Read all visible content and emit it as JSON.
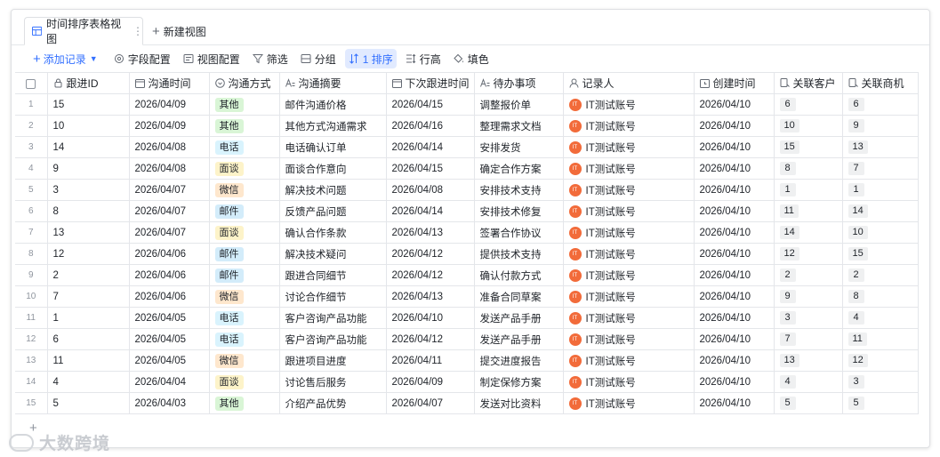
{
  "tabs": {
    "active_label": "时间排序表格视图",
    "more_label": "⋮",
    "new_view_label": "新建视图"
  },
  "toolbar": {
    "add_record_label": "添加记录",
    "field_config_label": "字段配置",
    "view_config_label": "视图配置",
    "filter_label": "筛选",
    "group_label": "分组",
    "sort_label": "1 排序",
    "row_height_label": "行高",
    "fill_label": "填色"
  },
  "columns": [
    {
      "label": "跟进ID",
      "icon": "lock-number-icon"
    },
    {
      "label": "沟通时间",
      "icon": "calendar-icon"
    },
    {
      "label": "沟通方式",
      "icon": "single-select-icon"
    },
    {
      "label": "沟通摘要",
      "icon": "text-icon"
    },
    {
      "label": "下次跟进时间",
      "icon": "calendar-icon"
    },
    {
      "label": "待办事项",
      "icon": "text-icon"
    },
    {
      "label": "记录人",
      "icon": "person-icon"
    },
    {
      "label": "创建时间",
      "icon": "created-time-icon"
    },
    {
      "label": "关联客户",
      "icon": "link-icon"
    },
    {
      "label": "关联商机",
      "icon": "link-icon"
    }
  ],
  "method_colors": {
    "其他": {
      "bg": "#d9f5d6",
      "fg": "#1f2329"
    },
    "电话": {
      "bg": "#d9f3fd",
      "fg": "#1f2329"
    },
    "面谈": {
      "bg": "#fdf3c9",
      "fg": "#1f2329"
    },
    "微信": {
      "bg": "#fee7cd",
      "fg": "#1f2329"
    },
    "邮件": {
      "bg": "#d3ecfa",
      "fg": "#1f2329"
    }
  },
  "recorder_avatar_text": "IT",
  "rows": [
    {
      "n": "1",
      "id": "15",
      "time": "2026/04/09",
      "method": "其他",
      "summary": "邮件沟通价格",
      "next": "2026/04/15",
      "todo": "调整报价单",
      "recorder": "IT测试账号",
      "created": "2026/04/10",
      "customer": "6",
      "opportunity": "6"
    },
    {
      "n": "2",
      "id": "10",
      "time": "2026/04/09",
      "method": "其他",
      "summary": "其他方式沟通需求",
      "next": "2026/04/16",
      "todo": "整理需求文档",
      "recorder": "IT测试账号",
      "created": "2026/04/10",
      "customer": "10",
      "opportunity": "9"
    },
    {
      "n": "3",
      "id": "14",
      "time": "2026/04/08",
      "method": "电话",
      "summary": "电话确认订单",
      "next": "2026/04/14",
      "todo": "安排发货",
      "recorder": "IT测试账号",
      "created": "2026/04/10",
      "customer": "15",
      "opportunity": "13"
    },
    {
      "n": "4",
      "id": "9",
      "time": "2026/04/08",
      "method": "面谈",
      "summary": "面谈合作意向",
      "next": "2026/04/15",
      "todo": "确定合作方案",
      "recorder": "IT测试账号",
      "created": "2026/04/10",
      "customer": "8",
      "opportunity": "7"
    },
    {
      "n": "5",
      "id": "3",
      "time": "2026/04/07",
      "method": "微信",
      "summary": "解决技术问题",
      "next": "2026/04/08",
      "todo": "安排技术支持",
      "recorder": "IT测试账号",
      "created": "2026/04/10",
      "customer": "1",
      "opportunity": "1"
    },
    {
      "n": "6",
      "id": "8",
      "time": "2026/04/07",
      "method": "邮件",
      "summary": "反馈产品问题",
      "next": "2026/04/14",
      "todo": "安排技术修复",
      "recorder": "IT测试账号",
      "created": "2026/04/10",
      "customer": "11",
      "opportunity": "14"
    },
    {
      "n": "7",
      "id": "13",
      "time": "2026/04/07",
      "method": "面谈",
      "summary": "确认合作条款",
      "next": "2026/04/13",
      "todo": "签署合作协议",
      "recorder": "IT测试账号",
      "created": "2026/04/10",
      "customer": "14",
      "opportunity": "10"
    },
    {
      "n": "8",
      "id": "12",
      "time": "2026/04/06",
      "method": "邮件",
      "summary": "解决技术疑问",
      "next": "2026/04/12",
      "todo": "提供技术支持",
      "recorder": "IT测试账号",
      "created": "2026/04/10",
      "customer": "12",
      "opportunity": "15"
    },
    {
      "n": "9",
      "id": "2",
      "time": "2026/04/06",
      "method": "邮件",
      "summary": "跟进合同细节",
      "next": "2026/04/12",
      "todo": "确认付款方式",
      "recorder": "IT测试账号",
      "created": "2026/04/10",
      "customer": "2",
      "opportunity": "2"
    },
    {
      "n": "10",
      "id": "7",
      "time": "2026/04/06",
      "method": "微信",
      "summary": "讨论合作细节",
      "next": "2026/04/13",
      "todo": "准备合同草案",
      "recorder": "IT测试账号",
      "created": "2026/04/10",
      "customer": "9",
      "opportunity": "8"
    },
    {
      "n": "11",
      "id": "1",
      "time": "2026/04/05",
      "method": "电话",
      "summary": "客户咨询产品功能",
      "next": "2026/04/10",
      "todo": "发送产品手册",
      "recorder": "IT测试账号",
      "created": "2026/04/10",
      "customer": "3",
      "opportunity": "4"
    },
    {
      "n": "12",
      "id": "6",
      "time": "2026/04/05",
      "method": "电话",
      "summary": "客户咨询产品功能",
      "next": "2026/04/12",
      "todo": "发送产品手册",
      "recorder": "IT测试账号",
      "created": "2026/04/10",
      "customer": "7",
      "opportunity": "11"
    },
    {
      "n": "13",
      "id": "11",
      "time": "2026/04/05",
      "method": "微信",
      "summary": "跟进项目进度",
      "next": "2026/04/11",
      "todo": "提交进度报告",
      "recorder": "IT测试账号",
      "created": "2026/04/10",
      "customer": "13",
      "opportunity": "12"
    },
    {
      "n": "14",
      "id": "4",
      "time": "2026/04/04",
      "method": "面谈",
      "summary": "讨论售后服务",
      "next": "2026/04/09",
      "todo": "制定保修方案",
      "recorder": "IT测试账号",
      "created": "2026/04/10",
      "customer": "4",
      "opportunity": "3"
    },
    {
      "n": "15",
      "id": "5",
      "time": "2026/04/03",
      "method": "其他",
      "summary": "介绍产品优势",
      "next": "2026/04/07",
      "todo": "发送对比资料",
      "recorder": "IT测试账号",
      "created": "2026/04/10",
      "customer": "5",
      "opportunity": "5"
    }
  ],
  "add_row_symbol": "+",
  "watermark_logo_text": "大数跨境"
}
